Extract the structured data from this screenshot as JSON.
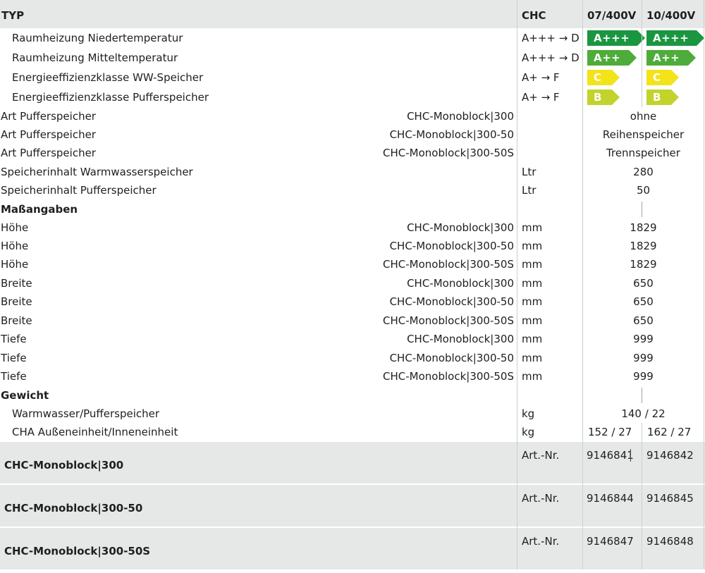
{
  "header": {
    "typ": "TYP",
    "chc": "CHC",
    "col1": "07/400V",
    "col2": "10/400V"
  },
  "energy": [
    {
      "label": "Raumheizung Niedertemperatur",
      "range": "A+++ → D",
      "class1": "A+++",
      "class2": "A+++",
      "color": "#1a9640"
    },
    {
      "label": "Raumheizung Mitteltemperatur",
      "range": "A+++ → D",
      "class1": "A++",
      "class2": "A++",
      "color": "#4eac3a"
    },
    {
      "label": "Energieeffizienzklasse WW-Speicher",
      "range": "A+ → F",
      "class1": "C",
      "class2": "C",
      "color": "#f2e31a"
    },
    {
      "label": "Energieeffizienzklasse Pufferspeicher",
      "range": "A+ → F",
      "class1": "B",
      "class2": "B",
      "color": "#c2d32b"
    }
  ],
  "art": [
    {
      "label": "Art Pufferspeicher",
      "model": "CHC-Monoblock|300",
      "value": "ohne"
    },
    {
      "label": "Art Pufferspeicher",
      "model": "CHC-Monoblock|300-50",
      "value": "Reihenspeicher"
    },
    {
      "label": "Art Pufferspeicher",
      "model": "CHC-Monoblock|300-50S",
      "value": "Trennspeicher"
    }
  ],
  "inhalt": [
    {
      "label": "Speicherinhalt Warmwasserspeicher",
      "unit": "Ltr",
      "value": "280"
    },
    {
      "label": "Speicherinhalt Pufferspeicher",
      "unit": "Ltr",
      "value": "50"
    }
  ],
  "section_mass": "Maßangaben",
  "dims": [
    {
      "label": "Höhe",
      "model": "CHC-Monoblock|300",
      "unit": "mm",
      "value": "1829"
    },
    {
      "label": "Höhe",
      "model": "CHC-Monoblock|300-50",
      "unit": "mm",
      "value": "1829"
    },
    {
      "label": "Höhe",
      "model": "CHC-Monoblock|300-50S",
      "unit": "mm",
      "value": "1829"
    },
    {
      "label": "Breite",
      "model": "CHC-Monoblock|300",
      "unit": "mm",
      "value": "650"
    },
    {
      "label": "Breite",
      "model": "CHC-Monoblock|300-50",
      "unit": "mm",
      "value": "650"
    },
    {
      "label": "Breite",
      "model": "CHC-Monoblock|300-50S",
      "unit": "mm",
      "value": "650"
    },
    {
      "label": "Tiefe",
      "model": "CHC-Monoblock|300",
      "unit": "mm",
      "value": "999"
    },
    {
      "label": "Tiefe",
      "model": "CHC-Monoblock|300-50",
      "unit": "mm",
      "value": "999"
    },
    {
      "label": "Tiefe",
      "model": "CHC-Monoblock|300-50S",
      "unit": "mm",
      "value": "999"
    }
  ],
  "section_gewicht": "Gewicht",
  "gewicht": [
    {
      "label": "Warmwasser/Pufferspeicher",
      "unit": "kg",
      "value": "140 / 22"
    },
    {
      "label": "CHA Außeneinheit/Inneneinheit",
      "unit": "kg",
      "value1": "152 / 27",
      "value2": "162 / 27"
    }
  ],
  "articles": [
    {
      "model": "CHC-Monoblock|300",
      "label": "Art.-Nr.",
      "nr1": "9146841",
      "nr2": "9146842"
    },
    {
      "model": "CHC-Monoblock|300-50",
      "label": "Art.-Nr.",
      "nr1": "9146844",
      "nr2": "9146845"
    },
    {
      "model": "CHC-Monoblock|300-50S",
      "label": "Art.-Nr.",
      "nr1": "9146847",
      "nr2": "9146848"
    }
  ]
}
